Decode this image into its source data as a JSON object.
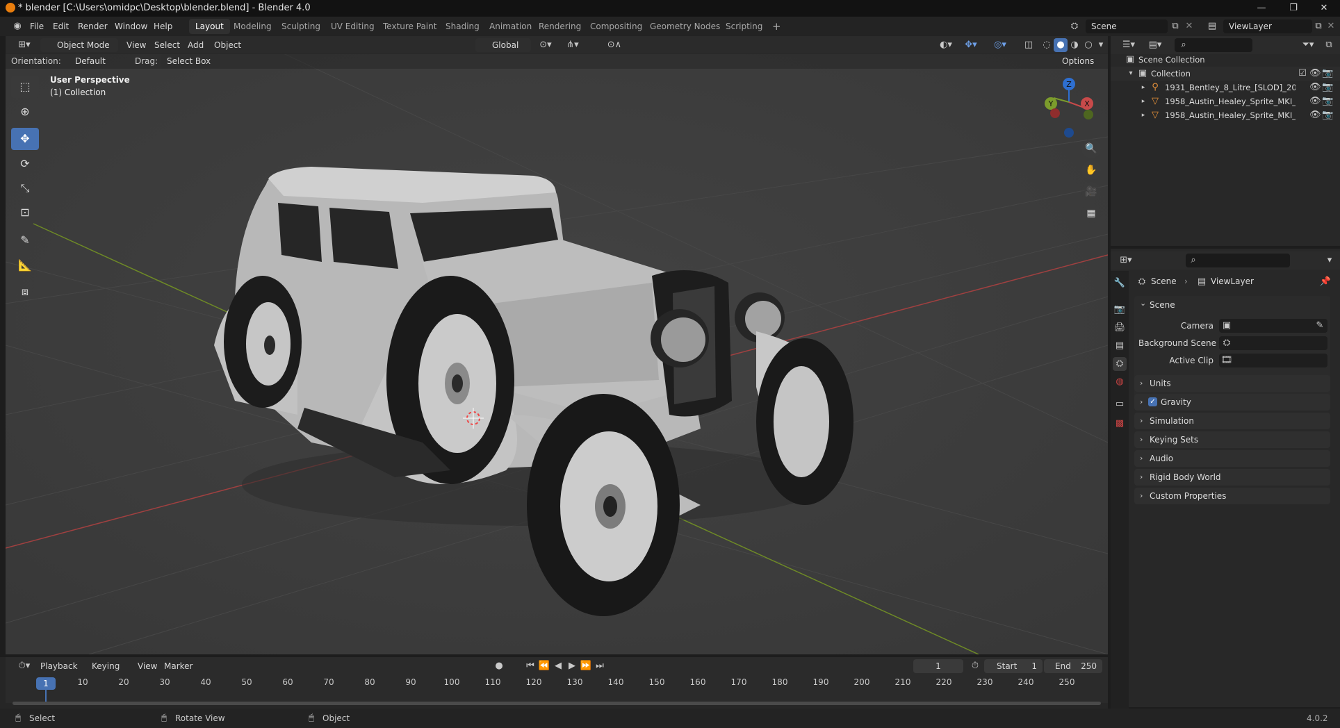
{
  "window": {
    "title": "* blender [C:\\Users\\omidpc\\Desktop\\blender.blend] - Blender 4.0",
    "controls": [
      "—",
      "❐",
      "✕"
    ]
  },
  "menu": [
    "File",
    "Edit",
    "Render",
    "Window",
    "Help"
  ],
  "workspaces": [
    "Layout",
    "Modeling",
    "Sculpting",
    "UV Editing",
    "Texture Paint",
    "Shading",
    "Animation",
    "Rendering",
    "Compositing",
    "Geometry Nodes",
    "Scripting"
  ],
  "add_workspace": "+",
  "scene_selector": "Scene",
  "viewlayer_selector": "ViewLayer",
  "viewport_header": {
    "mode": "Object Mode",
    "menus": [
      "View",
      "Select",
      "Add",
      "Object"
    ],
    "transform_orientation": "Global",
    "options_label": "Options"
  },
  "tool_settings": {
    "orientation_label": "Orientation:",
    "orientation_value": "Default",
    "drag_label": "Drag:",
    "drag_value": "Select Box"
  },
  "viewport": {
    "perspective_text": "User Perspective",
    "collection_text": "(1) Collection",
    "gizmo_axes": [
      "Z",
      "Y",
      "X"
    ],
    "colors": {
      "x_axis": "#c84a4a",
      "y_axis": "#7c9c2c",
      "z_axis": "#2e6fd1",
      "grid": "#474747",
      "selected_tool": "#4772b3"
    },
    "toolbar_icons": [
      "select-box-icon",
      "cursor-icon",
      "move-icon",
      "rotate-icon",
      "scale-icon",
      "transform-icon",
      "annotate-icon",
      "measure-icon",
      "add-cube-icon"
    ]
  },
  "outliner": {
    "root": "Scene Collection",
    "collection": "Collection",
    "items": [
      "1931_Bentley_8_Litre_[SLOD]_20",
      "1958_Austin_Healey_Sprite_MKI_",
      "1958_Austin_Healey_Sprite_MKI_"
    ]
  },
  "properties": {
    "breadcrumb": [
      "Scene",
      "ViewLayer"
    ],
    "section": "Scene",
    "fields": [
      {
        "label": "Camera"
      },
      {
        "label": "Background Scene"
      },
      {
        "label": "Active Clip"
      }
    ],
    "panels": [
      "Units",
      "Gravity",
      "Simulation",
      "Keying Sets",
      "Audio",
      "Rigid Body World",
      "Custom Properties"
    ],
    "gravity_checked": true
  },
  "timeline": {
    "menus": [
      "Playback",
      "Keying",
      "View",
      "Marker"
    ],
    "current_frame": "1",
    "start_label": "Start",
    "start_value": "1",
    "end_label": "End",
    "end_value": "250",
    "ticks": [
      "10",
      "20",
      "30",
      "40",
      "50",
      "60",
      "70",
      "80",
      "90",
      "100",
      "110",
      "120",
      "130",
      "140",
      "150",
      "160",
      "170",
      "180",
      "190",
      "200",
      "210",
      "220",
      "230",
      "240",
      "250"
    ],
    "playhead": "1"
  },
  "statusbar": {
    "items": [
      "Select",
      "Rotate View",
      "Object"
    ],
    "version": "4.0.2"
  }
}
